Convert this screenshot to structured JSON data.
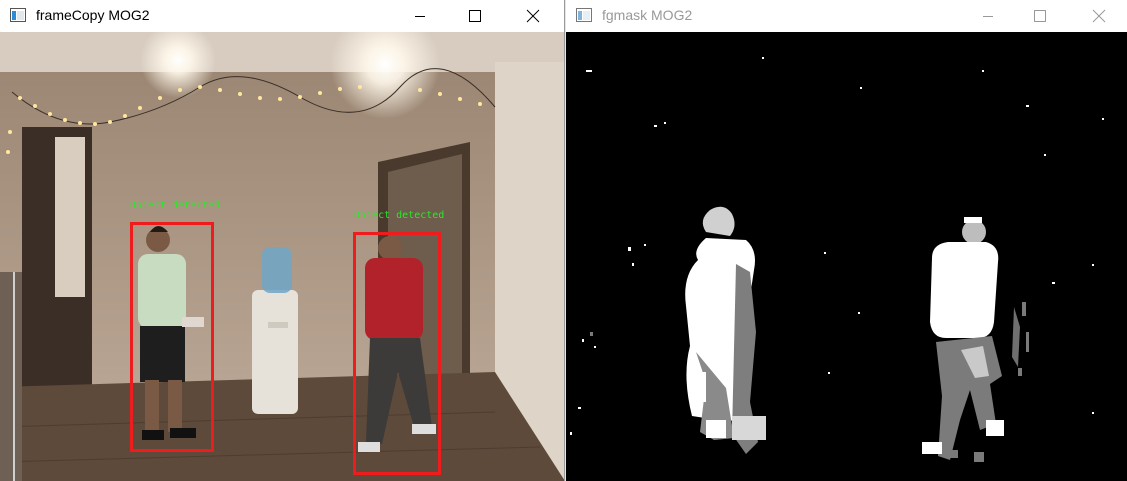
{
  "left_window": {
    "title": "frameCopy MOG2",
    "detections": [
      {
        "label": "Object detected"
      },
      {
        "label": "Object detected"
      }
    ]
  },
  "right_window": {
    "title": "fgmask MOG2"
  },
  "colors": {
    "box_red": "#ee1c1c",
    "label_green": "#22ee22",
    "mask_black": "#000000",
    "mask_white": "#ffffff"
  },
  "icons": [
    "app-window-icon",
    "minimize-icon",
    "maximize-icon",
    "close-icon"
  ]
}
